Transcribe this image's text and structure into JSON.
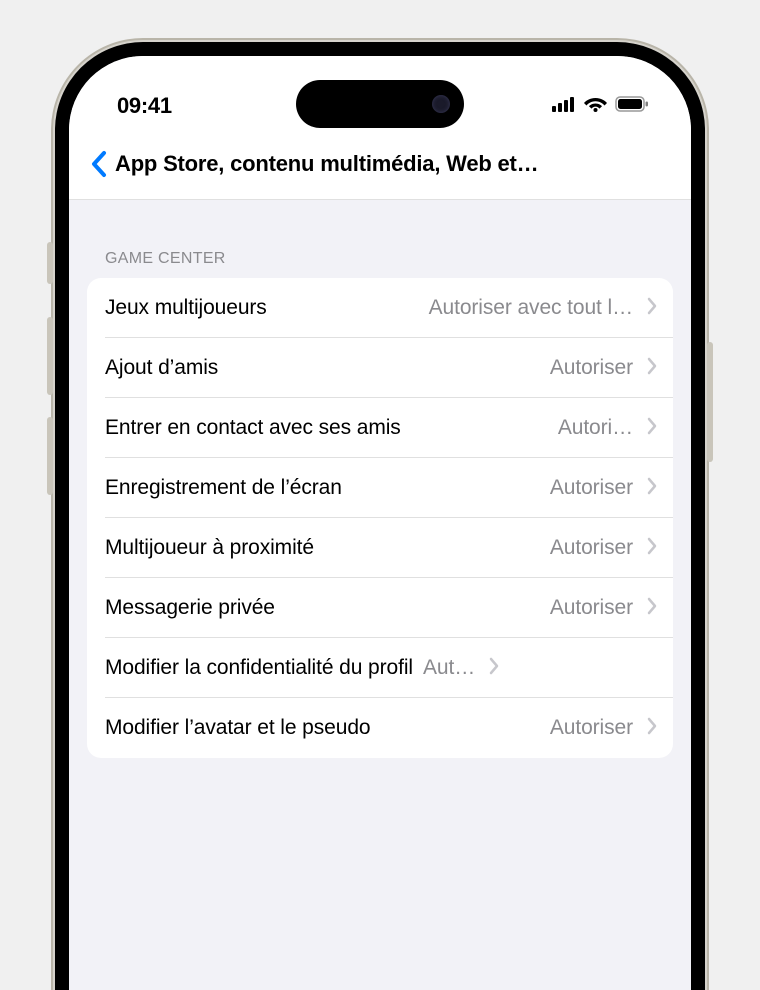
{
  "status": {
    "time": "09:41"
  },
  "nav": {
    "title": "App Store, contenu multimédia, Web et…"
  },
  "section": {
    "header": "GAME CENTER"
  },
  "rows": [
    {
      "label": "Jeux multijoueurs",
      "value": "Autoriser avec tout l…"
    },
    {
      "label": "Ajout d’amis",
      "value": "Autoriser"
    },
    {
      "label": "Entrer en contact avec ses amis",
      "value": "Autori…"
    },
    {
      "label": "Enregistrement de l’écran",
      "value": "Autoriser"
    },
    {
      "label": "Multijoueur à proximité",
      "value": "Autoriser"
    },
    {
      "label": "Messagerie privée",
      "value": "Autoriser"
    },
    {
      "label": "Modifier la confidentialité du profil",
      "value": "Aut…"
    },
    {
      "label": "Modifier l’avatar et le pseudo",
      "value": "Autoriser"
    }
  ],
  "colors": {
    "back_chevron": "#007aff",
    "secondary_text": "#8a8a8e"
  }
}
